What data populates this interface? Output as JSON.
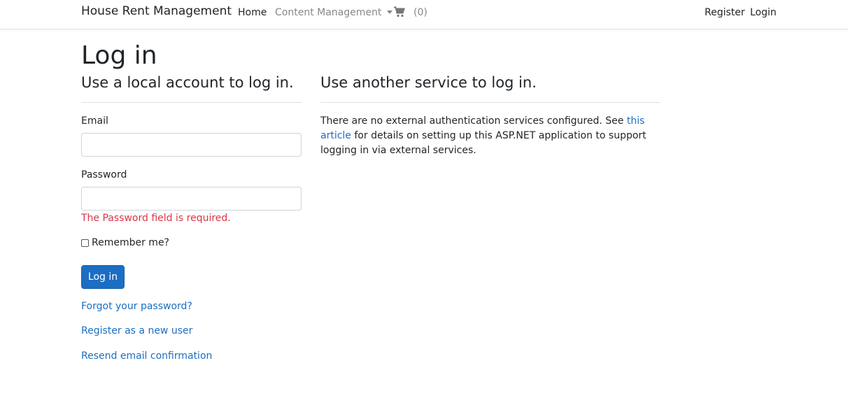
{
  "navbar": {
    "brand": "House Rent Management",
    "home": "Home",
    "content_management": "Content Management",
    "cart_count": "(0)",
    "register": "Register",
    "login": "Login"
  },
  "page": {
    "title": "Log in",
    "local_heading": "Use a local account to log in.",
    "external_heading": "Use another service to log in."
  },
  "form": {
    "email_label": "Email",
    "email_value": "",
    "password_label": "Password",
    "password_value": "",
    "password_error": "The Password field is required.",
    "remember_label": "Remember me?",
    "submit_label": "Log in"
  },
  "links": {
    "forgot_password": "Forgot your password?",
    "register_new": "Register as a new user",
    "resend_confirmation": "Resend email confirmation"
  },
  "external": {
    "text_before": "There are no external authentication services configured. See ",
    "article_link": "this article",
    "text_after": " for details on setting up this ASP.NET application to support logging in via external services."
  },
  "colors": {
    "accent": "#1b6ec2",
    "error": "#dc3545"
  }
}
